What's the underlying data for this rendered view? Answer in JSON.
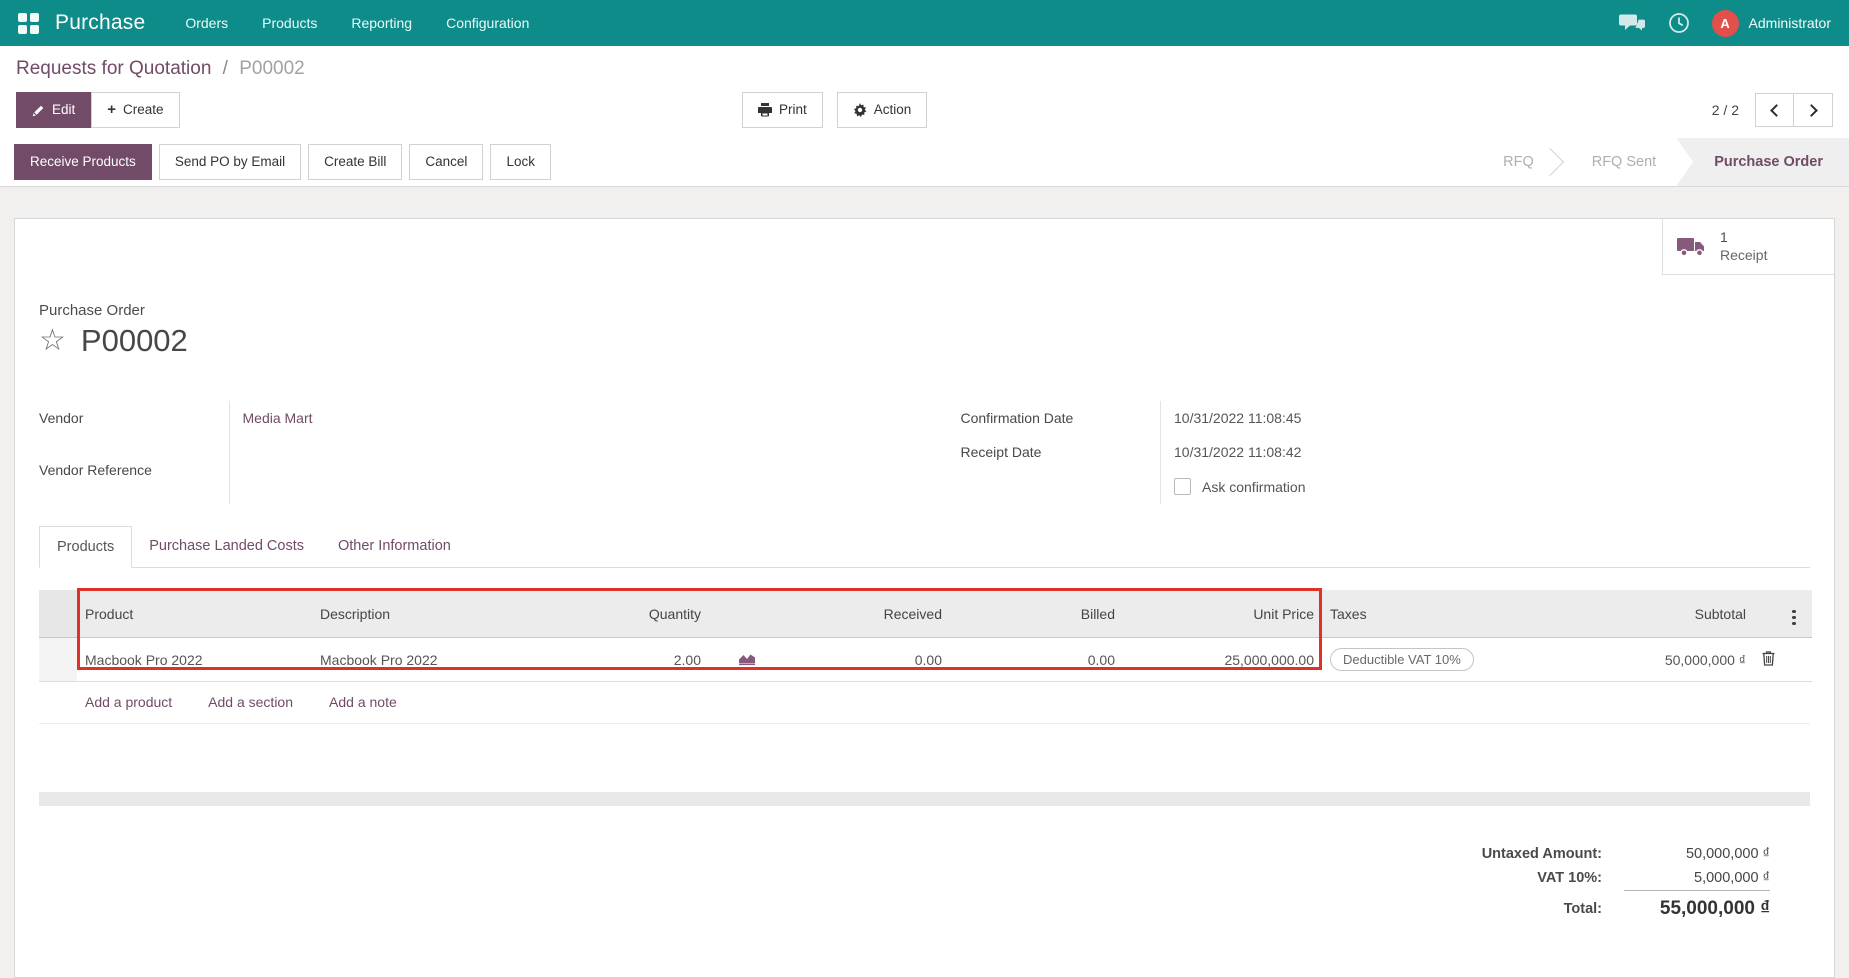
{
  "navbar": {
    "app_name": "Purchase",
    "menus": [
      "Orders",
      "Products",
      "Reporting",
      "Configuration"
    ],
    "user": {
      "initial": "A",
      "name": "Administrator"
    },
    "colors": {
      "bg": "#0e8c89",
      "avatar": "#e2504c"
    }
  },
  "breadcrumb": {
    "parent": "Requests for Quotation",
    "separator": "/",
    "current": "P00002"
  },
  "control_panel": {
    "edit_label": "Edit",
    "create_label": "Create",
    "print_label": "Print",
    "action_label": "Action",
    "pager": "2 / 2"
  },
  "statusbar": {
    "buttons": [
      {
        "label": "Receive Products",
        "primary": true
      },
      {
        "label": "Send PO by Email"
      },
      {
        "label": "Create Bill"
      },
      {
        "label": "Cancel"
      },
      {
        "label": "Lock"
      }
    ],
    "states": [
      {
        "label": "RFQ",
        "active": false
      },
      {
        "label": "RFQ Sent",
        "active": false
      },
      {
        "label": "Purchase Order",
        "active": true
      }
    ]
  },
  "sheet": {
    "button_box": {
      "count": "1",
      "label": "Receipt"
    },
    "title_label": "Purchase Order",
    "title": "P00002",
    "fields_left": [
      {
        "label": "Vendor",
        "value": "Media Mart"
      },
      {
        "label": "Vendor Reference",
        "value": ""
      }
    ],
    "fields_right": [
      {
        "label": "Confirmation Date",
        "value": "10/31/2022 11:08:45"
      },
      {
        "label": "Receipt Date",
        "value": "10/31/2022 11:08:42"
      }
    ],
    "checkbox_label": "Ask confirmation",
    "tabs": [
      {
        "label": "Products",
        "active": true
      },
      {
        "label": "Purchase Landed Costs",
        "active": false
      },
      {
        "label": "Other Information",
        "active": false
      }
    ],
    "table": {
      "columns": [
        "Product",
        "Description",
        "Quantity",
        "",
        "Received",
        "Billed",
        "Unit Price",
        "Taxes",
        "Subtotal"
      ],
      "rows": [
        {
          "product": "Macbook Pro 2022",
          "description": "Macbook Pro 2022",
          "quantity": "2.00",
          "received": "0.00",
          "billed": "0.00",
          "unit_price": "25,000,000.00",
          "taxes": "Deductible VAT 10%",
          "subtotal": "50,000,000 ₫"
        }
      ],
      "footer_links": [
        "Add a product",
        "Add a section",
        "Add a note"
      ]
    },
    "totals": [
      {
        "label": "Untaxed Amount:",
        "value": "50,000,000 ₫"
      },
      {
        "label": "VAT 10%:",
        "value": "5,000,000 ₫"
      },
      {
        "label": "Total:",
        "value": "55,000,000 ₫"
      }
    ],
    "annotation_color": "#e0302a"
  }
}
